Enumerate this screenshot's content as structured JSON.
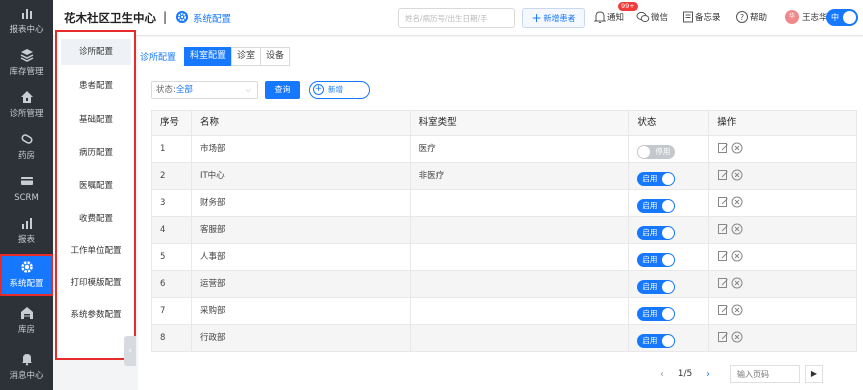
{
  "leftnav": {
    "items": [
      {
        "label": "报表中心",
        "icon": "bar-chart-icon"
      },
      {
        "label": "库存管理",
        "icon": "layers-icon"
      },
      {
        "label": "诊所管理",
        "icon": "house-icon"
      },
      {
        "label": "药房",
        "icon": "pill-icon"
      },
      {
        "label": "SCRM",
        "icon": "card-icon"
      },
      {
        "label": "报表",
        "icon": "bar-chart-icon"
      },
      {
        "label": "系统配置",
        "icon": "gear-icon"
      },
      {
        "label": "库房",
        "icon": "warehouse-icon"
      },
      {
        "label": "消息中心",
        "icon": "bell-icon"
      }
    ]
  },
  "header": {
    "clinic_name": "花木社区卫生中心",
    "separator": "|",
    "section": "系统配置",
    "search_placeholder": "姓名/病历号/出生日期/手",
    "add_patient": "新增患者",
    "notify_badge": "99+",
    "notify": "通知",
    "wechat": "微信",
    "memo": "备忘录",
    "help": "帮助",
    "avatar_text": "华",
    "username": "王志华",
    "lang": "中"
  },
  "settings_menu": [
    "诊所配置",
    "患者配置",
    "基础配置",
    "病历配置",
    "医嘱配置",
    "收费配置",
    "工作单位配置",
    "打印模版配置",
    "系统参数配置"
  ],
  "main": {
    "breadcrumb": "诊所配置",
    "tabs": [
      "科室配置",
      "诊室",
      "设备"
    ],
    "filter": {
      "label": "状态:",
      "value": "全部"
    },
    "query_button": "查询",
    "add_button": "新增",
    "table": {
      "headers": [
        "序号",
        "名称",
        "科室类型",
        "状态",
        "操作"
      ],
      "rows": [
        {
          "no": "1",
          "name": "市场部",
          "type": "医疗",
          "status": "停用",
          "enabled": false
        },
        {
          "no": "2",
          "name": "IT中心",
          "type": "非医疗",
          "status": "启用",
          "enabled": true
        },
        {
          "no": "3",
          "name": "财务部",
          "type": "",
          "status": "启用",
          "enabled": true
        },
        {
          "no": "4",
          "name": "客服部",
          "type": "",
          "status": "启用",
          "enabled": true
        },
        {
          "no": "5",
          "name": "人事部",
          "type": "",
          "status": "启用",
          "enabled": true
        },
        {
          "no": "6",
          "name": "运营部",
          "type": "",
          "status": "启用",
          "enabled": true
        },
        {
          "no": "7",
          "name": "采购部",
          "type": "",
          "status": "启用",
          "enabled": true
        },
        {
          "no": "8",
          "name": "行政部",
          "type": "",
          "status": "启用",
          "enabled": true
        }
      ]
    },
    "pagination": {
      "current": "1/5",
      "input_placeholder": "输入页码",
      "go": "▶"
    }
  },
  "colors": {
    "accent": "#1677ff",
    "nav_bg": "#2d3138",
    "highlight": "#e62b2b"
  }
}
